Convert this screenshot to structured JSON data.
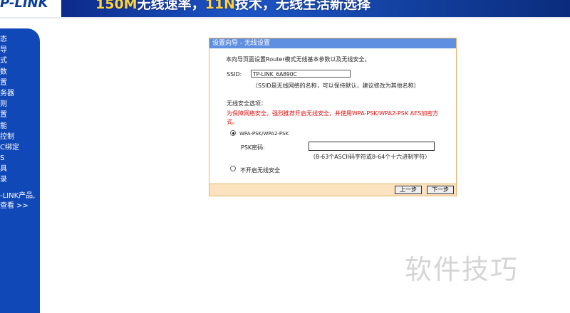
{
  "banner": {
    "logo": "P-LINK",
    "slogan_a": "150M",
    "slogan_b": "无线速率，",
    "slogan_c": "11N",
    "slogan_d": "技术，无线生活新选择"
  },
  "sidebar": {
    "items": [
      "态",
      "导",
      "式",
      "数",
      "置",
      "务器",
      "则",
      "置",
      "能",
      "控制",
      "C绑定",
      "S",
      "具",
      "录"
    ],
    "note_line1": "-LINK产品,",
    "note_line2": "查看 >>"
  },
  "wizard": {
    "title": "设置向导 - 无线设置",
    "intro": "本向导页面设置Router模式无线基本参数以及无线安全。",
    "ssid_label": "SSID:",
    "ssid_value": "TP-LINK_6A890C",
    "ssid_hint": "（SSID是无线网络的名称，可以保持默认，建议修改为其他名称）",
    "security_heading": "无线安全选项：",
    "security_warning_line1": "为保障网络安全，强烈推荐开启无线安全，并使用WPA-PSK/WPA2-PSK AES加密方",
    "security_warning_line2": "式。",
    "option_wpa_label": "WPA-PSK/WPA2-PSK",
    "psk_label": "PSK密码:",
    "psk_value": "",
    "psk_hint": "（8-63个ASCII码字符或8-64个十六进制字符）",
    "option_off_label": "不开启无线安全",
    "prev_button": "上一步",
    "next_button": "下一步"
  },
  "watermark": "软件技巧",
  "colors": {
    "sidebar_bg": "#1148b8",
    "title_bar": "#5f8fe0",
    "panel_border": "#e7b36a",
    "footer_bg": "#fbe3bf",
    "warning_text": "#e01010"
  }
}
